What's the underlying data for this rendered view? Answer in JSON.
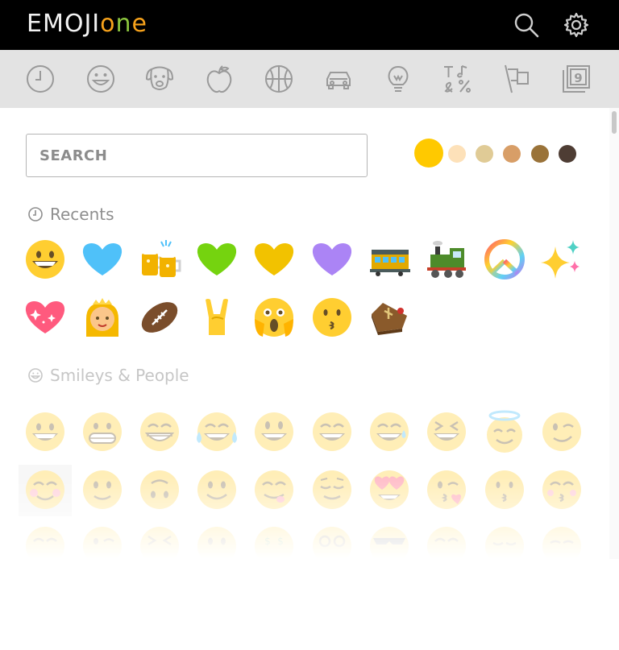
{
  "header": {
    "logo_part1": "EMOJI",
    "logo_o": "o",
    "logo_n": "n",
    "logo_e": "e",
    "icons": [
      "search-icon",
      "gear-icon"
    ]
  },
  "categories": [
    {
      "name": "recent",
      "icon": "clock-icon"
    },
    {
      "name": "people",
      "icon": "smiley-icon"
    },
    {
      "name": "nature",
      "icon": "dog-icon"
    },
    {
      "name": "food",
      "icon": "apple-icon"
    },
    {
      "name": "activity",
      "icon": "basketball-icon"
    },
    {
      "name": "travel",
      "icon": "car-icon"
    },
    {
      "name": "objects",
      "icon": "lightbulb-icon"
    },
    {
      "name": "symbols",
      "icon": "symbols-icon"
    },
    {
      "name": "flags",
      "icon": "flag-icon"
    },
    {
      "name": "regional",
      "icon": "keycap-icon"
    }
  ],
  "search": {
    "placeholder": "SEARCH"
  },
  "tones": [
    "#ffc900",
    "#fde1b9",
    "#e0cb96",
    "#d89e67",
    "#9a7339",
    "#4e3d34"
  ],
  "sections": {
    "recents": {
      "title": "Recents"
    },
    "smileys": {
      "title": "Smileys & People"
    }
  },
  "recents": [
    "grinning",
    "blue-heart",
    "beers",
    "green-heart",
    "yellow-heart",
    "purple-heart",
    "railway-car",
    "steam-locomotive",
    "peace-symbol",
    "sparkles",
    "sparkling-heart",
    "princess",
    "football",
    "horns-sign",
    "scream",
    "kissing",
    "coffin"
  ]
}
